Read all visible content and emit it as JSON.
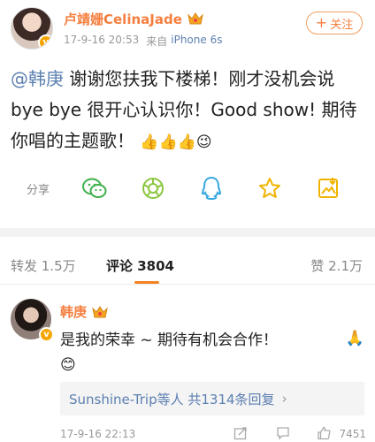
{
  "post": {
    "username": "卢靖姗CelinaJade",
    "timestamp": "17-9-16 20:53",
    "source_prefix": "来自",
    "source": "iPhone 6s",
    "follow_label": "关注",
    "mention": "@韩庚",
    "text": " 谢谢您扶我下楼梯！刚才没机会说bye bye 很开心认识你！Good show! 期待你唱的主题歌！",
    "emojis": "👍👍👍😉"
  },
  "share": {
    "label": "分享",
    "icons": [
      "wechat-icon",
      "moments-icon",
      "qq-icon",
      "favorite-star-icon",
      "save-image-icon"
    ]
  },
  "tabs": {
    "repost": "转发 1.5万",
    "comment": "评论 3804",
    "like": "赞 2.1万"
  },
  "comment": {
    "username": "韩庚",
    "text": "是我的荣幸 ~ 期待有机会合作！",
    "smile": "😊",
    "praise_emoji": "🙏",
    "replies": "Sunshine-Trip等人  共1314条回复",
    "chevron": "›",
    "timestamp": "17-9-16 22:13",
    "like_count": "7451"
  },
  "colors": {
    "name_orange": "#f57f3f",
    "link_blue": "#5b7fb0",
    "tab_indicator": "#f78222"
  }
}
